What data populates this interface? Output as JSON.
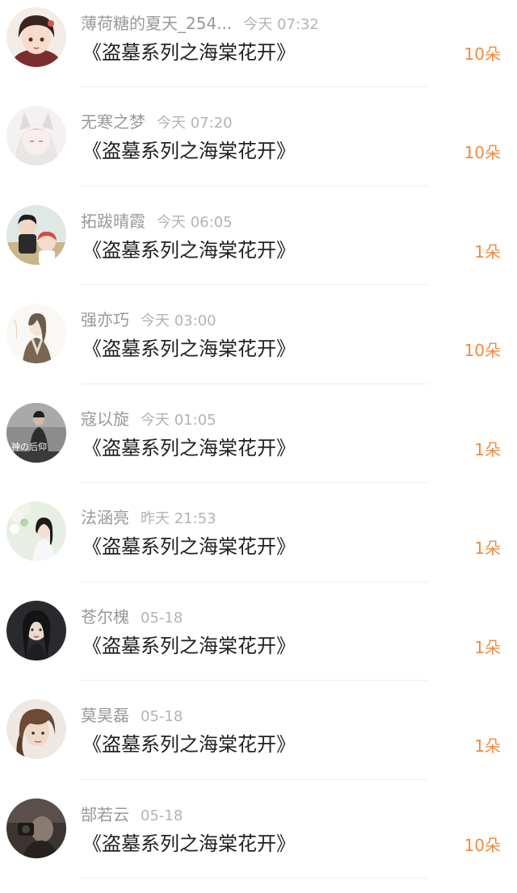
{
  "book_title": "《盗墓系列之海棠花开》",
  "accent_color": "#f08a3e",
  "rows": [
    {
      "name": "薄荷糖的夏天_254...",
      "time": "今天 07:32",
      "title": "《盗墓系列之海棠花开》",
      "count": "10朵",
      "avatar_icon": "avatar-anime-girl"
    },
    {
      "name": "无寒之梦",
      "time": "今天 07:20",
      "title": "《盗墓系列之海棠花开》",
      "count": "10朵",
      "avatar_icon": "avatar-white-hair"
    },
    {
      "name": "拓跋晴霞",
      "time": "今天 06:05",
      "title": "《盗墓系列之海棠花开》",
      "count": "1朵",
      "avatar_icon": "avatar-cartoon-duo"
    },
    {
      "name": "强亦巧",
      "time": "今天 03:00",
      "title": "《盗墓系列之海棠花开》",
      "count": "10朵",
      "avatar_icon": "avatar-sketch-man"
    },
    {
      "name": "寇以旋",
      "time": "今天 01:05",
      "title": "《盗墓系列之海棠花开》",
      "count": "1朵",
      "avatar_icon": "avatar-photo-man",
      "avatar_text": "神の后仰"
    },
    {
      "name": "法涵亮",
      "time": "昨天 21:53",
      "title": "《盗墓系列之海棠花开》",
      "count": "1朵",
      "avatar_icon": "avatar-flower-girl"
    },
    {
      "name": "苍尔槐",
      "time": "05-18",
      "title": "《盗墓系列之海棠花开》",
      "count": "1朵",
      "avatar_icon": "avatar-dark-girl"
    },
    {
      "name": "莫昊磊",
      "time": "05-18",
      "title": "《盗墓系列之海棠花开》",
      "count": "1朵",
      "avatar_icon": "avatar-portrait-woman"
    },
    {
      "name": "郜若云",
      "time": "05-18",
      "title": "《盗墓系列之海棠花开》",
      "count": "10朵",
      "avatar_icon": "avatar-dark-camera"
    }
  ]
}
